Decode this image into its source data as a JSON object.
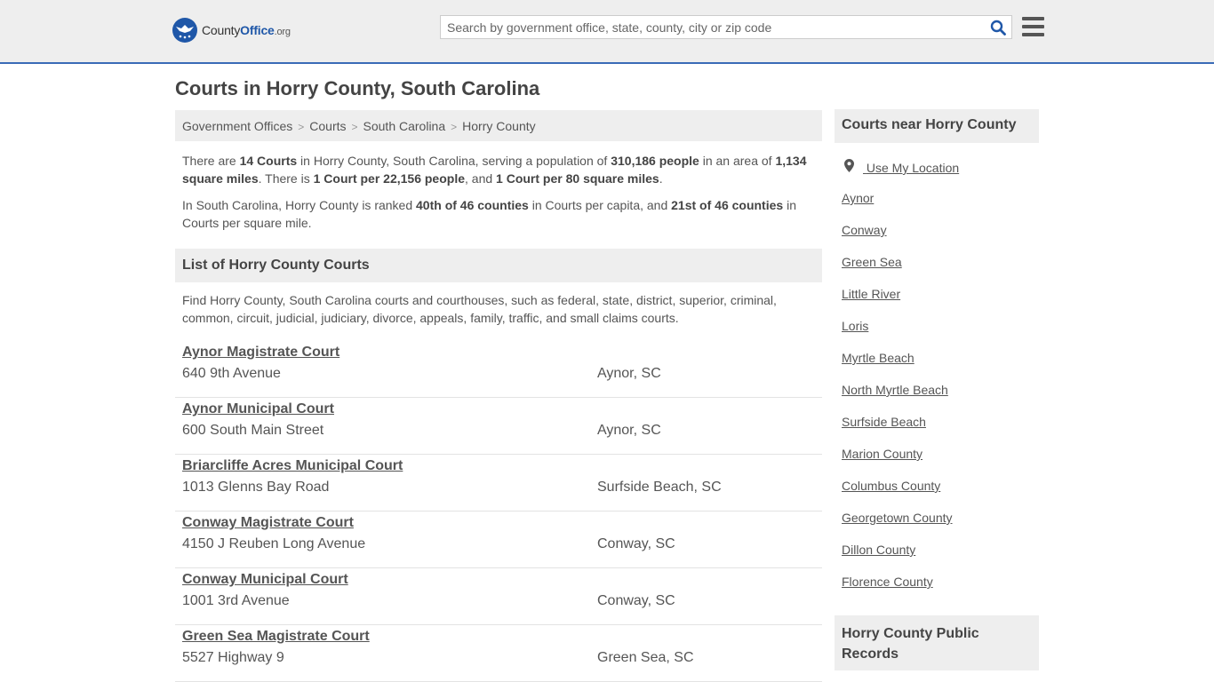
{
  "header": {
    "logo": {
      "part1": "County",
      "part2": "Office",
      "part3": ".org"
    },
    "search_placeholder": "Search by government office, state, county, city or zip code"
  },
  "page_title": "Courts in Horry County, South Carolina",
  "breadcrumb": [
    "Government Offices",
    "Courts",
    "South Carolina",
    "Horry County"
  ],
  "intro": {
    "p1": [
      {
        "t": "There are ",
        "b": false
      },
      {
        "t": "14 Courts",
        "b": true
      },
      {
        "t": " in Horry County, South Carolina, serving a population of ",
        "b": false
      },
      {
        "t": "310,186 people",
        "b": true
      },
      {
        "t": " in an area of ",
        "b": false
      },
      {
        "t": "1,134 square miles",
        "b": true
      },
      {
        "t": ". There is ",
        "b": false
      },
      {
        "t": "1 Court per 22,156 people",
        "b": true
      },
      {
        "t": ", and ",
        "b": false
      },
      {
        "t": "1 Court per 80 square miles",
        "b": true
      },
      {
        "t": ".",
        "b": false
      }
    ],
    "p2": [
      {
        "t": "In South Carolina, Horry County is ranked ",
        "b": false
      },
      {
        "t": "40th of 46 counties",
        "b": true
      },
      {
        "t": " in Courts per capita, and ",
        "b": false
      },
      {
        "t": "21st of 46 counties",
        "b": true
      },
      {
        "t": " in Courts per square mile.",
        "b": false
      }
    ]
  },
  "list_section": {
    "title": "List of Horry County Courts",
    "description": "Find Horry County, South Carolina courts and courthouses, such as federal, state, district, superior, criminal, common, circuit, judicial, judiciary, divorce, appeals, family, traffic, and small claims courts."
  },
  "courts": [
    {
      "name": "Aynor Magistrate Court",
      "address": "640 9th Avenue",
      "city": "Aynor, SC"
    },
    {
      "name": "Aynor Municipal Court",
      "address": "600 South Main Street",
      "city": "Aynor, SC"
    },
    {
      "name": "Briarcliffe Acres Municipal Court",
      "address": "1013 Glenns Bay Road",
      "city": "Surfside Beach, SC"
    },
    {
      "name": "Conway Magistrate Court",
      "address": "4150 J Reuben Long Avenue",
      "city": "Conway, SC"
    },
    {
      "name": "Conway Municipal Court",
      "address": "1001 3rd Avenue",
      "city": "Conway, SC"
    },
    {
      "name": "Green Sea Magistrate Court",
      "address": "5527 Highway 9",
      "city": "Green Sea, SC"
    }
  ],
  "sidebar": {
    "title": "Courts near Horry County",
    "use_location": "Use My Location",
    "links": [
      "Aynor",
      "Conway",
      "Green Sea",
      "Little River",
      "Loris",
      "Myrtle Beach",
      "North Myrtle Beach",
      "Surfside Beach",
      "Marion County",
      "Columbus County",
      "Georgetown County",
      "Dillon County",
      "Florence County"
    ],
    "records_title": "Horry County Public Records"
  }
}
